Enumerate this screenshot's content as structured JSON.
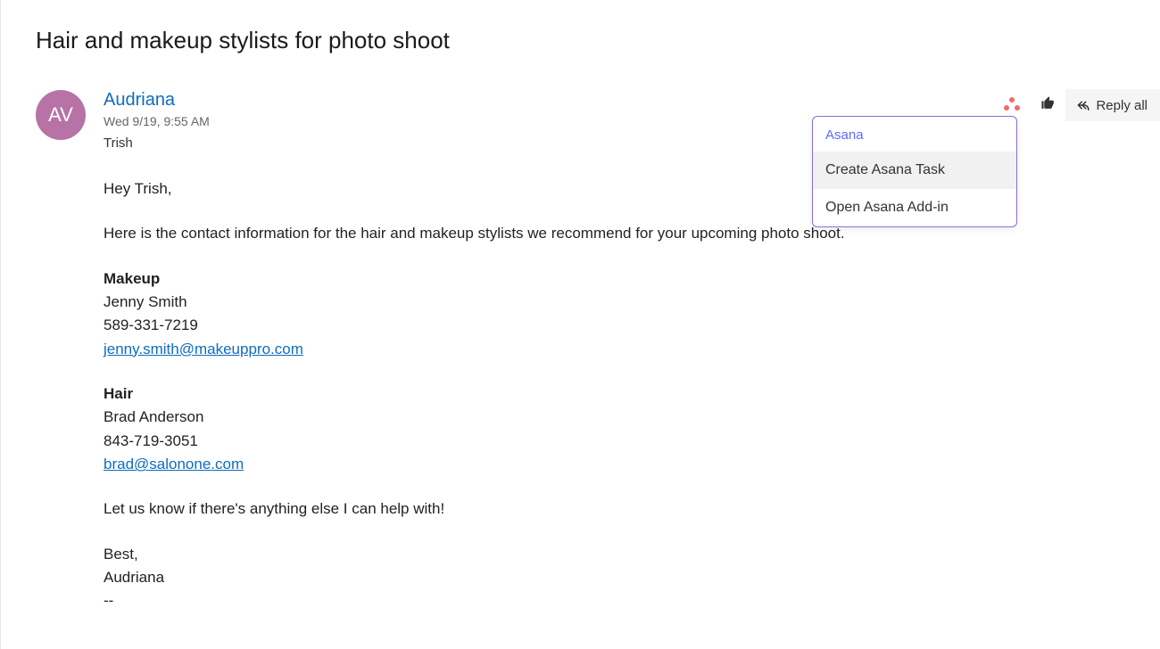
{
  "email": {
    "subject": "Hair and makeup stylists for photo shoot",
    "sender": {
      "initials": "AV",
      "name": "Audriana"
    },
    "sent_date": "Wed 9/19, 9:55 AM",
    "recipient": "Trish",
    "body": {
      "greeting": "Hey Trish,",
      "intro": "Here is the contact information for the hair and makeup stylists we recommend for your upcoming photo shoot.",
      "makeup": {
        "label": "Makeup",
        "name": "Jenny Smith",
        "phone": "589-331-7219",
        "email": "jenny.smith@makeuppro.com"
      },
      "hair": {
        "label": "Hair",
        "name": "Brad Anderson",
        "phone": "843-719-3051",
        "email": "brad@salonone.com"
      },
      "closing": "Let us know if there's anything else I can help with!",
      "signoff": "Best,",
      "signature": "Audriana",
      "sep": "--"
    }
  },
  "actions": {
    "reply_all_label": "Reply all"
  },
  "dropdown": {
    "title": "Asana",
    "item_create": "Create Asana Task",
    "item_open": "Open Asana Add-in"
  }
}
